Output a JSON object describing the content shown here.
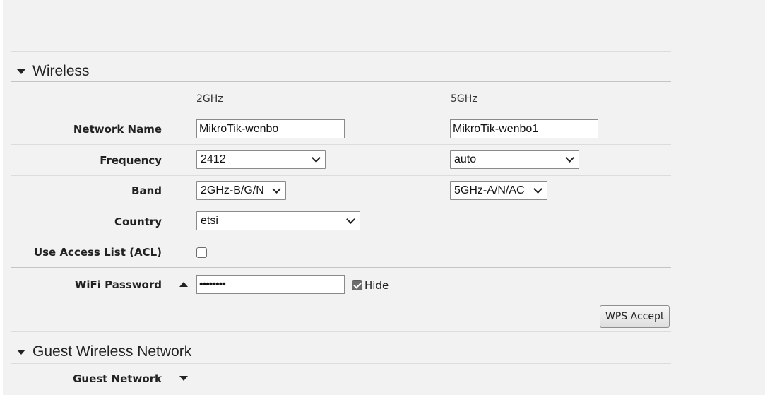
{
  "wireless": {
    "title": "Wireless",
    "columns": {
      "band_2ghz": "2GHz",
      "band_5ghz": "5GHz"
    },
    "network_name": {
      "label": "Network Name",
      "value_2ghz": "MikroTik-wenbo",
      "value_5ghz": "MikroTik-wenbo1"
    },
    "frequency": {
      "label": "Frequency",
      "value_2ghz": "2412",
      "value_5ghz": "auto"
    },
    "band": {
      "label": "Band",
      "value_2ghz": "2GHz-B/G/N",
      "value_5ghz": "5GHz-A/N/AC"
    },
    "country": {
      "label": "Country",
      "value": "etsi"
    },
    "acl": {
      "label": "Use Access List (ACL)",
      "checked": false
    },
    "wifi_password": {
      "label": "WiFi Password",
      "value": "••••••••",
      "hide_label": "Hide",
      "hide_checked": true
    },
    "wps_button": "WPS Accept"
  },
  "guest": {
    "title": "Guest Wireless Network",
    "guest_network_label": "Guest Network"
  },
  "colors": {
    "background": "#f2f2f2",
    "rule": "#dcdcdc",
    "checkbox_checked": "#6d6d6d"
  }
}
